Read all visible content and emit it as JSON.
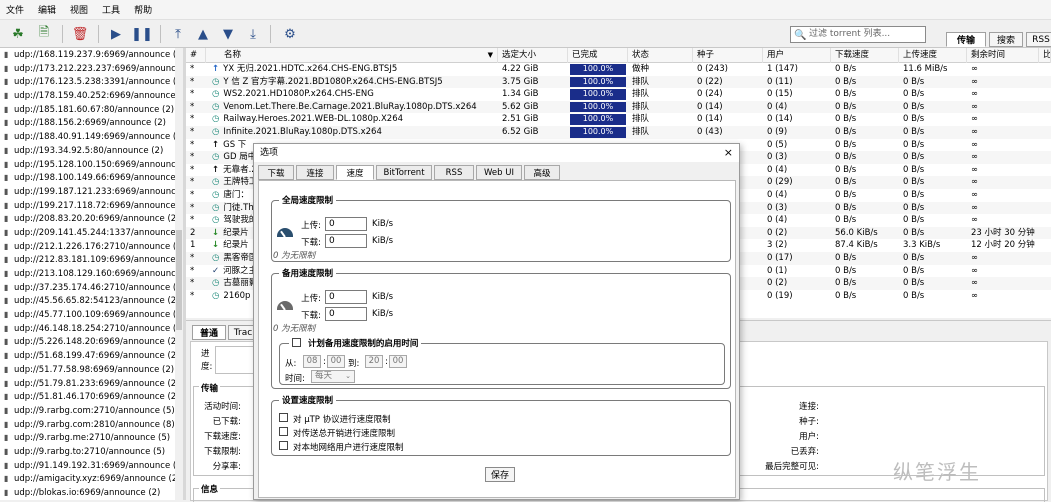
{
  "menu": [
    "文件",
    "编辑",
    "视图",
    "工具",
    "帮助"
  ],
  "search": {
    "placeholder": "过滤 torrent 列表..."
  },
  "top_tabs": [
    "传输",
    "搜索",
    "RSS"
  ],
  "trackers": [
    "udp://168.119.237.9:6969/announce (2)",
    "udp://173.212.223.237:6969/announce (2)",
    "udp://176.123.5.238:3391/announce (2)",
    "udp://178.159.40.252:6969/announce (2)",
    "udp://185.181.60.67:80/announce (2)",
    "udp://188.156.2:6969/announce (2)",
    "udp://188.40.91.149:6969/announce (2)",
    "udp://193.34.92.5:80/announce (2)",
    "udp://195.128.100.150:6969/announce (2)",
    "udp://198.100.149.66:6969/announce (2)",
    "udp://199.187.121.233:6969/announce (2)",
    "udp://199.217.118.72:6969/announce (2)",
    "udp://208.83.20.20:6969/announce (2)",
    "udp://209.141.45.244:1337/announce (2)",
    "udp://212.1.226.176:2710/announce (2)",
    "udp://212.83.181.109:6969/announce (2)",
    "udp://213.108.129.160:6969/announce (2)",
    "udp://37.235.174.46:2710/announce (2)",
    "udp://45.56.65.82:54123/announce (2)",
    "udp://45.77.100.109:6969/announce (2)",
    "udp://46.148.18.254:2710/announce (2)",
    "udp://5.226.148.20:6969/announce (2)",
    "udp://51.68.199.47:6969/announce (2)",
    "udp://51.77.58.98:6969/announce (2)",
    "udp://51.79.81.233:6969/announce (2)",
    "udp://51.81.46.170:6969/announce (2)",
    "udp://9.rarbg.com:2710/announce (5)",
    "udp://9.rarbg.com:2810/announce (8)",
    "udp://9.rarbg.me:2710/announce (5)",
    "udp://9.rarbg.to:2710/announce (5)",
    "udp://91.149.192.31:6969/announce (2)",
    "udp://amigacity.xyz:6969/announce (2)",
    "udp://blokas.io:6969/announce (2)"
  ],
  "columns": {
    "num": "#",
    "name": "名称",
    "size": "选定大小",
    "done": "已完成",
    "status": "状态",
    "seeds": "种子",
    "peers": "用户",
    "down": "下载速度",
    "up": "上传速度",
    "eta": "剩余时间",
    "ratio": "比"
  },
  "torrents": [
    {
      "num": "*",
      "icon": "up",
      "name": "YX 无归.2021.HDTC.x264.CHS-ENG.BTSJ5",
      "size": "4.22 GiB",
      "done": "100.0%",
      "done_pct": 100,
      "status": "做种",
      "seeds": "0 (243)",
      "peers": "1 (147)",
      "down": "0 B/s",
      "up": "11.6 MiB/s",
      "eta": "∞"
    },
    {
      "num": "*",
      "icon": "queue",
      "name": "Y 信 Z 官方字幕.2021.BD1080P.x264.CHS-ENG.BTSJ5",
      "size": "3.75 GiB",
      "done": "100.0%",
      "done_pct": 100,
      "status": "排队",
      "seeds": "0 (22)",
      "peers": "0 (11)",
      "down": "0 B/s",
      "up": "0 B/s",
      "eta": "∞"
    },
    {
      "num": "*",
      "icon": "queue",
      "name": "WS2.2021.HD1080P.x264.CHS-ENG",
      "size": "1.34 GiB",
      "done": "100.0%",
      "done_pct": 100,
      "status": "排队",
      "seeds": "0 (24)",
      "peers": "0 (15)",
      "down": "0 B/s",
      "up": "0 B/s",
      "eta": "∞"
    },
    {
      "num": "*",
      "icon": "queue",
      "name": "Venom.Let.There.Be.Carnage.2021.BluRay.1080p.DTS.x264",
      "size": "5.62 GiB",
      "done": "100.0%",
      "done_pct": 100,
      "status": "排队",
      "seeds": "0 (14)",
      "peers": "0 (4)",
      "down": "0 B/s",
      "up": "0 B/s",
      "eta": "∞"
    },
    {
      "num": "*",
      "icon": "queue",
      "name": "Railway.Heroes.2021.WEB-DL.1080p.X264",
      "size": "2.51 GiB",
      "done": "100.0%",
      "done_pct": 100,
      "status": "排队",
      "seeds": "0 (14)",
      "peers": "0 (14)",
      "down": "0 B/s",
      "up": "0 B/s",
      "eta": "∞"
    },
    {
      "num": "*",
      "icon": "queue",
      "name": "Infinite.2021.BluRay.1080p.DTS.x264",
      "size": "6.52 GiB",
      "done": "100.0%",
      "done_pct": 100,
      "status": "排队",
      "seeds": "0 (43)",
      "peers": "0 (9)",
      "down": "0 B/s",
      "up": "0 B/s",
      "eta": "∞"
    },
    {
      "num": "*",
      "icon": "up-black",
      "name": "GS 下",
      "size": "",
      "done": "",
      "done_pct": 0,
      "status": "",
      "seeds": "",
      "peers": "0 (5)",
      "down": "0 B/s",
      "up": "0 B/s",
      "eta": "∞"
    },
    {
      "num": "*",
      "icon": "queue",
      "name": "GD 局中",
      "size": "",
      "done": "",
      "done_pct": 0,
      "status": "",
      "seeds": "",
      "peers": "0 (3)",
      "down": "0 B/s",
      "up": "0 B/s",
      "eta": "∞"
    },
    {
      "num": "*",
      "icon": "up-black",
      "name": "无靠者.2",
      "size": "",
      "done": "",
      "done_pct": 0,
      "status": "",
      "seeds": "",
      "peers": "0 (4)",
      "down": "0 B/s",
      "up": "0 B/s",
      "eta": "∞"
    },
    {
      "num": "*",
      "icon": "queue",
      "name": "王牌特工",
      "size": "",
      "done": "",
      "done_pct": 0,
      "status": "",
      "seeds": "",
      "peers": "0 (29)",
      "down": "0 B/s",
      "up": "0 B/s",
      "eta": "∞"
    },
    {
      "num": "*",
      "icon": "queue",
      "name": "唐门：",
      "size": "",
      "done": "",
      "done_pct": 0,
      "status": "",
      "seeds": "",
      "peers": "0 (4)",
      "down": "0 B/s",
      "up": "0 B/s",
      "eta": "∞"
    },
    {
      "num": "*",
      "icon": "queue",
      "name": "门徒.Th",
      "size": "",
      "done": "",
      "done_pct": 0,
      "status": "",
      "seeds": "",
      "peers": "0 (3)",
      "down": "0 B/s",
      "up": "0 B/s",
      "eta": "∞"
    },
    {
      "num": "*",
      "icon": "queue",
      "name": "驾驶我的",
      "size": "",
      "done": "",
      "done_pct": 0,
      "status": "",
      "seeds": "",
      "peers": "0 (4)",
      "down": "0 B/s",
      "up": "0 B/s",
      "eta": "∞"
    },
    {
      "num": "2",
      "icon": "down",
      "name": "纪录片",
      "size": "",
      "done": "",
      "done_pct": 0,
      "status": "",
      "seeds": "",
      "peers": "0 (2)",
      "down": "56.0 KiB/s",
      "up": "0 B/s",
      "eta": "23 小时 30 分钟"
    },
    {
      "num": "1",
      "icon": "down",
      "name": "纪录片",
      "size": "",
      "done": "",
      "done_pct": 0,
      "status": "",
      "seeds": "",
      "peers": "3 (2)",
      "down": "87.4 KiB/s",
      "up": "3.3 KiB/s",
      "eta": "12 小时 20 分钟"
    },
    {
      "num": "*",
      "icon": "queue",
      "name": "黑客帝国",
      "size": "",
      "done": "",
      "done_pct": 0,
      "status": "",
      "seeds": "",
      "peers": "0 (17)",
      "down": "0 B/s",
      "up": "0 B/s",
      "eta": "∞"
    },
    {
      "num": "*",
      "icon": "check",
      "name": "河豚之主",
      "size": "",
      "done": "",
      "done_pct": 0,
      "status": "",
      "seeds": "",
      "peers": "0 (1)",
      "down": "0 B/s",
      "up": "0 B/s",
      "eta": "∞"
    },
    {
      "num": "*",
      "icon": "queue",
      "name": "古墓丽影",
      "size": "",
      "done": "",
      "done_pct": 0,
      "status": "",
      "seeds": "",
      "peers": "0 (2)",
      "down": "0 B/s",
      "up": "0 B/s",
      "eta": "∞"
    },
    {
      "num": "*",
      "icon": "queue",
      "name": "2160p",
      "size": "",
      "done": "",
      "done_pct": 0,
      "status": "",
      "seeds": "",
      "peers": "0 (19)",
      "down": "0 B/s",
      "up": "0 B/s",
      "eta": "∞"
    }
  ],
  "bottom": {
    "tabs": [
      "普通",
      "Trac"
    ],
    "progress_label": "进度:",
    "transfer_legend": "传输",
    "left_labels": [
      "活动时间:",
      "已下载:",
      "下载速度:",
      "下载限制:",
      "分享率:"
    ],
    "right_labels": [
      "连接:",
      "种子:",
      "用户:",
      "已丢弃:",
      "最后完整可见:"
    ],
    "info_legend": "信息"
  },
  "dialog": {
    "title": "选项",
    "close": "×",
    "tabs": [
      "下载",
      "连接",
      "速度",
      "BitTorrent",
      "RSS",
      "Web UI",
      "高级"
    ],
    "global_legend": "全局速度限制",
    "upload_label": "上传:",
    "download_label": "下载:",
    "global_up": "0",
    "global_down": "0",
    "unit": "KiB/s",
    "zero_note": "0 为无限制",
    "alt_legend": "备用速度限制",
    "alt_up": "0",
    "alt_down": "0",
    "schedule_label": "计划备用速度限制的启用时间",
    "from_label": "从:",
    "to_label": "到:",
    "from_h": "08",
    "from_m": "00",
    "to_h": "20",
    "to_m": "00",
    "time_sep": ":",
    "when_label": "时间:",
    "when_value": "每天",
    "settings_legend": "设置速度限制",
    "options": [
      "对 µTP 协议进行速度限制",
      "对传送总开销进行速度限制",
      "对本地网络用户进行速度限制"
    ],
    "save": "保存"
  },
  "watermark": "纵笔浮生"
}
